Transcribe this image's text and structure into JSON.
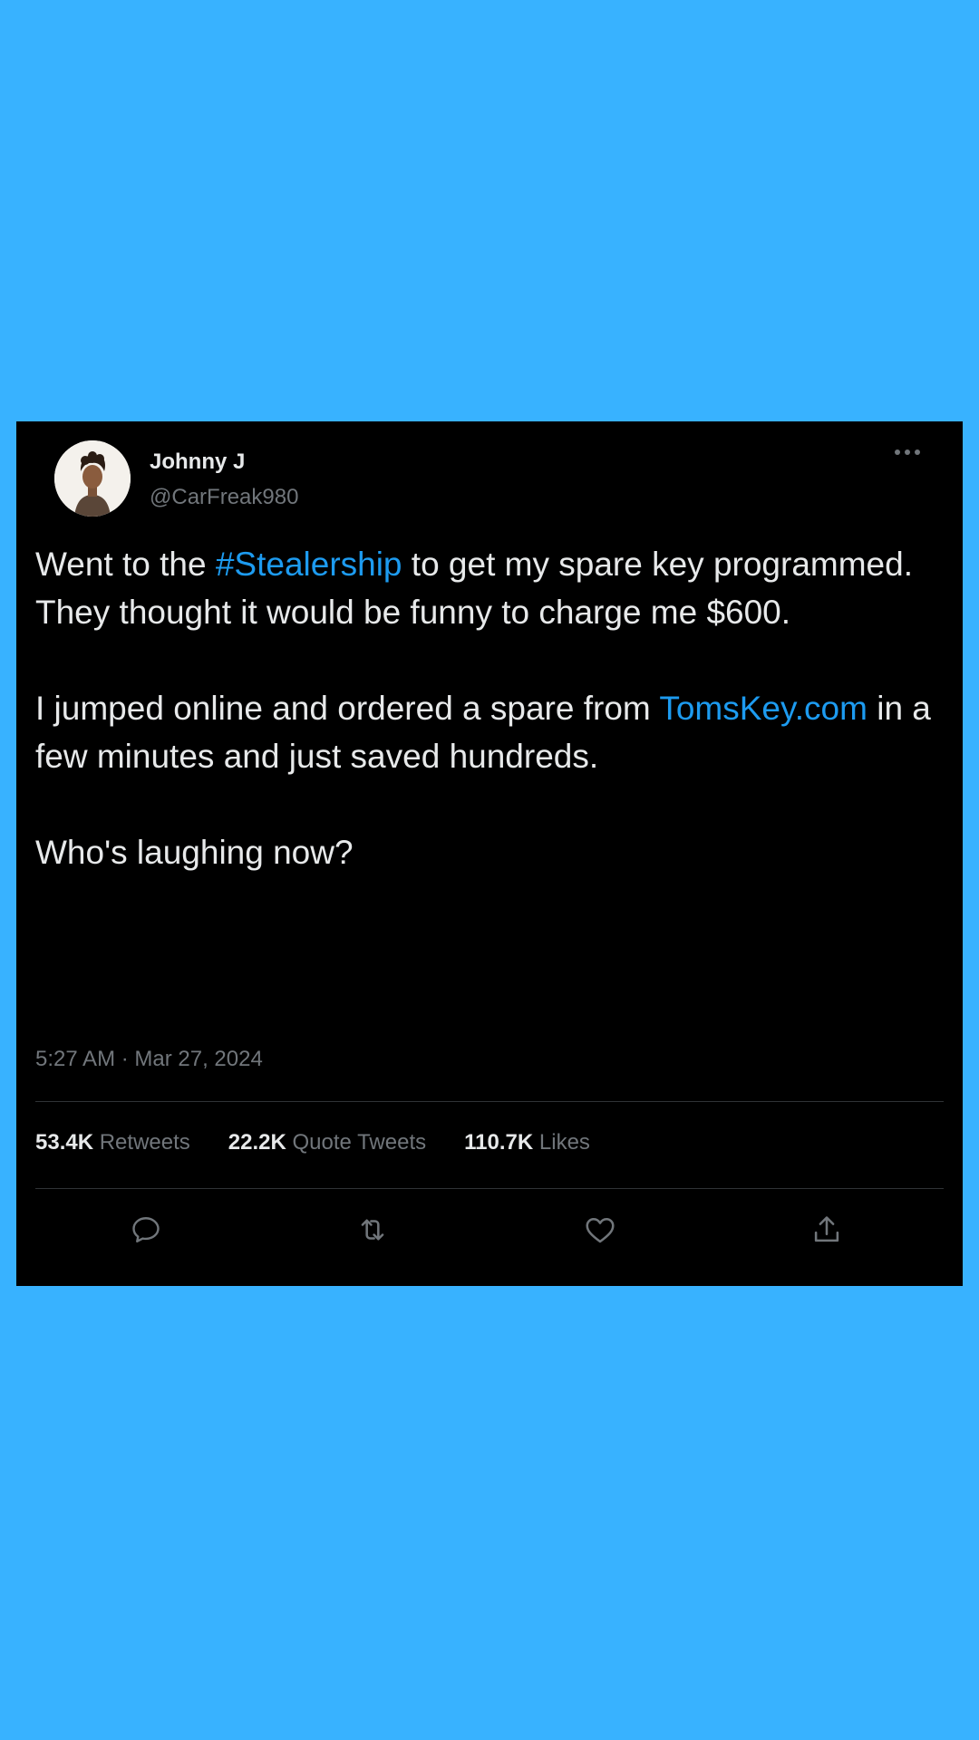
{
  "author": {
    "display_name": "Johnny J",
    "handle": "@CarFreak980"
  },
  "tweet": {
    "p1_before": "Went to the ",
    "hashtag": "#Stealership",
    "p1_after": " to get my spare key programmed. They thought it would be funny to charge me $600.",
    "p2_before": "I jumped online and ordered a spare from ",
    "link": "TomsKey.com",
    "p2_after": " in a few minutes and just saved hundreds.",
    "p3": "Who's laughing now?"
  },
  "timestamp": "5:27 AM · Mar 27, 2024",
  "stats": {
    "retweets_count": "53.4K",
    "retweets_label": "Retweets",
    "quotes_count": "22.2K",
    "quotes_label": "Quote Tweets",
    "likes_count": "110.7K",
    "likes_label": "Likes"
  },
  "icons": {
    "more": "more-icon",
    "reply": "reply-icon",
    "retweet": "retweet-icon",
    "like": "heart-icon",
    "share": "share-icon"
  },
  "colors": {
    "background": "#38b2ff",
    "card": "#000000",
    "text": "#e7e9ea",
    "muted": "#71767b",
    "link": "#1d9bf0",
    "divider": "#2f3336"
  }
}
